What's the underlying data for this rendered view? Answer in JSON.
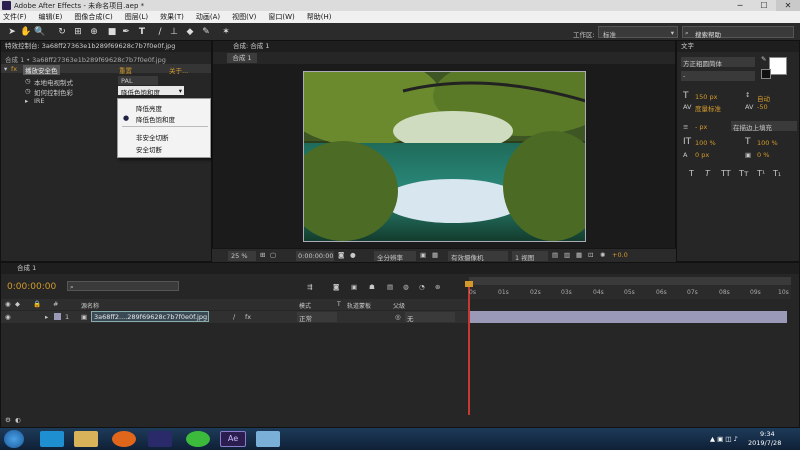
{
  "window": {
    "title": "Adobe After Effects - 未命名项目.aep *"
  },
  "menu": [
    "文件(F)",
    "编辑(E)",
    "图像合成(C)",
    "图层(L)",
    "效果(T)",
    "动画(A)",
    "视图(V)",
    "窗口(W)",
    "帮助(H)"
  ],
  "toolbar": {
    "workspace_label": "工作区:",
    "workspace_value": "标准",
    "search_placeholder": "搜索帮助"
  },
  "effect_controls": {
    "tab": "特效控制台: 3a68ff27363e1b289f69628c7b7f0e0f.jpg",
    "breadcrumb": "合成 1 • 3a68ff27363e1b289f69628c7b7f0e0f.jpg",
    "effect": {
      "fx": "fx",
      "name": "播放安全色",
      "reset": "重置",
      "about": "关于..."
    },
    "props": [
      {
        "label": "本地电视制式",
        "value": "PAL"
      },
      {
        "label": "如何控制色彩",
        "value": "降低色饱和度"
      },
      {
        "label": "IRE",
        "value": ""
      }
    ],
    "dropdown": [
      "降低亮度",
      "降低色饱和度",
      "非安全切断",
      "安全切断"
    ],
    "dropdown_selected": 1
  },
  "viewer": {
    "tab": "合成: 合成 1",
    "subtab": "合成 1",
    "zoom": "25 %",
    "timecode": "0:00:00:00",
    "resolution": "全分辨率",
    "camera": "有效摄像机",
    "views": "1 视图",
    "exposure": "+0.0"
  },
  "text_panel": {
    "tab": "文字",
    "font": "方正粗圆简体",
    "style": "-",
    "size": "150 px",
    "leading": "自动",
    "kerning": "度量标准",
    "tracking": "-50",
    "stroke_width": "- px",
    "stroke_type": "在描边上填充",
    "vscale": "100 %",
    "hscale": "100 %",
    "baseline": "0 px",
    "tsume": "0 %",
    "styles": [
      "T",
      "T",
      "TT",
      "Tт",
      "T¹",
      "T₁"
    ]
  },
  "timeline": {
    "tab": "合成 1",
    "timecode": "0:00:00:00",
    "search_placeholder": "",
    "columns": [
      "源名称",
      "模式",
      "T",
      "轨道蒙板",
      "父级"
    ],
    "layers": [
      {
        "index": "1",
        "name": "3a68ff2....289f69628c7b7f0e0f.jpg",
        "mode": "正常",
        "parent": "无"
      }
    ],
    "ruler": [
      "0s",
      "01s",
      "02s",
      "03s",
      "04s",
      "05s",
      "06s",
      "07s",
      "08s",
      "09s",
      "10s"
    ]
  },
  "taskbar": {
    "time": "9:34",
    "date": "2019/7/28"
  },
  "colors": {
    "accent": "#d39a2b",
    "playhead": "#c43a31",
    "layer_bar": "#9a9ab8"
  }
}
